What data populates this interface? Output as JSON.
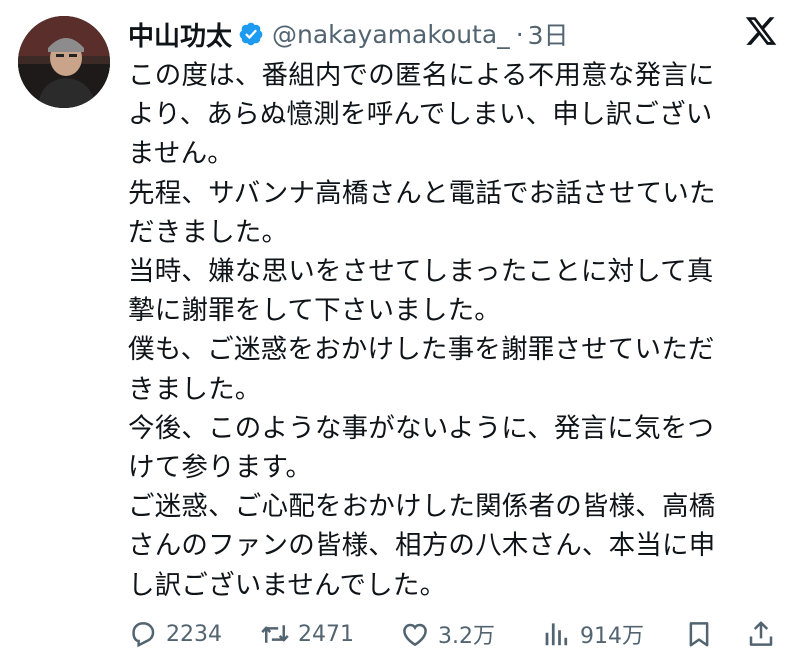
{
  "author": {
    "display_name": "中山功太",
    "handle": "@nakayamakouta_",
    "separator": "·",
    "time": "3日",
    "verified": true,
    "verified_color": "#1d9bf0",
    "avatar_icon": "profile-photo"
  },
  "platform_icon": "x-logo",
  "tweet": {
    "lines": [
      "この度は、番組内での匿名による不用意な発言に",
      "より、あらぬ憶測を呼んでしまい、申し訳ござい",
      "ません。",
      "先程、サバンナ高橋さんと電話でお話させていた",
      "だきました。",
      "当時、嫌な思いをさせてしまったことに対して真",
      "摯に謝罪をして下さいました。",
      "僕も、ご迷惑をおかけした事を謝罪させていただ",
      "きました。",
      "今後、このような事がないように、発言に気をつ",
      "けて参ります。",
      "ご迷惑、ご心配をおかけした関係者の皆様、高橋",
      "さんのファンの皆様、相方の八木さん、本当に申",
      "し訳ございませんでした。"
    ]
  },
  "actions": {
    "reply": {
      "icon": "reply-icon",
      "count": "2234"
    },
    "retweet": {
      "icon": "retweet-icon",
      "count": "2471"
    },
    "like": {
      "icon": "heart-icon",
      "count": "3.2万"
    },
    "views": {
      "icon": "analytics-icon",
      "count": "914万"
    },
    "bookmark": {
      "icon": "bookmark-icon"
    },
    "share": {
      "icon": "share-icon"
    }
  },
  "colors": {
    "text": "#0f1419",
    "secondary": "#536471",
    "verified": "#1d9bf0"
  }
}
